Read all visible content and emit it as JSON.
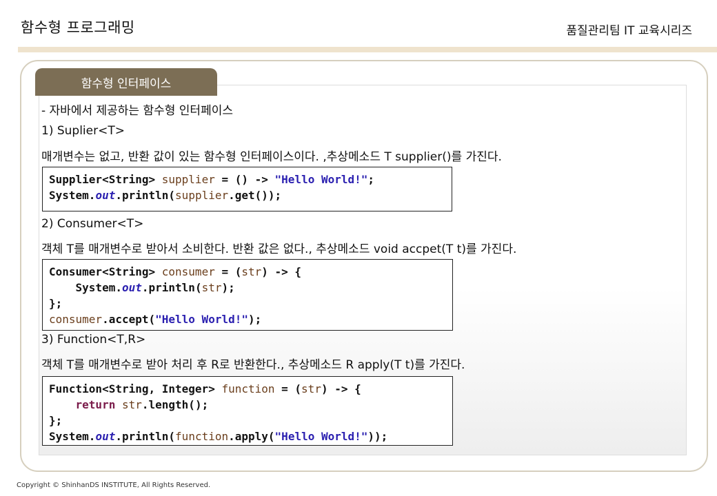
{
  "header": {
    "title": "함수형 프로그래밍",
    "org": "품질관리팀 IT 교육시리즈"
  },
  "section": {
    "tab_label": "함수형 인터페이스",
    "intro": "- 자바에서 제공하는 함수형 인터페이스"
  },
  "items": [
    {
      "heading": "1) Suplier<T>",
      "description": "매개변수는 없고, 반환 값이 있는 함수형 인터페이스이다. ,추상메소드 T supplier()를 가진다.",
      "code_lines": [
        [
          [
            "Supplier<String> ",
            "type"
          ],
          [
            "supplier",
            "var"
          ],
          [
            " = () -> ",
            "plain"
          ],
          [
            "\"Hello World!\"",
            "str"
          ],
          [
            ";",
            "plain"
          ]
        ],
        [
          [
            "System.",
            "plain"
          ],
          [
            "out",
            "fld"
          ],
          [
            ".println(",
            "plain"
          ],
          [
            "supplier",
            "var"
          ],
          [
            ".get());",
            "plain"
          ]
        ]
      ]
    },
    {
      "heading": "2) Consumer<T>",
      "description": "객체 T를 매개변수로 받아서 소비한다. 반환 값은 없다., 추상메소드 void accpet(T t)를 가진다.",
      "code_lines": [
        [
          [
            "Consumer<String> ",
            "type"
          ],
          [
            "consumer",
            "var"
          ],
          [
            " = (",
            "plain"
          ],
          [
            "str",
            "var"
          ],
          [
            ") -> {",
            "plain"
          ]
        ],
        [
          [
            "    System.",
            "plain"
          ],
          [
            "out",
            "fld"
          ],
          [
            ".println(",
            "plain"
          ],
          [
            "str",
            "var"
          ],
          [
            ");",
            "plain"
          ]
        ],
        [
          [
            "};",
            "plain"
          ]
        ],
        [
          [
            "consumer",
            "var"
          ],
          [
            ".accept(",
            "plain"
          ],
          [
            "\"Hello World!\"",
            "str"
          ],
          [
            ");",
            "plain"
          ]
        ]
      ]
    },
    {
      "heading": "3) Function<T,R>",
      "description": "객체 T를 매개변수로 받아 처리 후 R로 반환한다., 추상메소드 R apply(T t)를 가진다.",
      "code_lines": [
        [
          [
            "Function<String, Integer> ",
            "type"
          ],
          [
            "function",
            "var"
          ],
          [
            " = (",
            "plain"
          ],
          [
            "str",
            "var"
          ],
          [
            ") -> {",
            "plain"
          ]
        ],
        [
          [
            "    ",
            "plain"
          ],
          [
            "return",
            "kw"
          ],
          [
            " ",
            "plain"
          ],
          [
            "str",
            "var"
          ],
          [
            ".length();",
            "plain"
          ]
        ],
        [
          [
            "};",
            "plain"
          ]
        ],
        [
          [
            "System.",
            "plain"
          ],
          [
            "out",
            "fld"
          ],
          [
            ".println(",
            "plain"
          ],
          [
            "function",
            "var"
          ],
          [
            ".apply(",
            "plain"
          ],
          [
            "\"Hello World!\"",
            "str"
          ],
          [
            "));",
            "plain"
          ]
        ]
      ]
    }
  ],
  "footer": {
    "copyright": "Copyright © ShinhanDS INSTITUTE, All Rights Reserved."
  },
  "colors": {
    "tab_bg": "#7c6e55",
    "header_bar": "#efe3cd",
    "frame_border": "#d6cfbe",
    "code_string": "#2a1fb0",
    "code_variable": "#6a3e1c",
    "code_keyword": "#7a1b4a"
  }
}
